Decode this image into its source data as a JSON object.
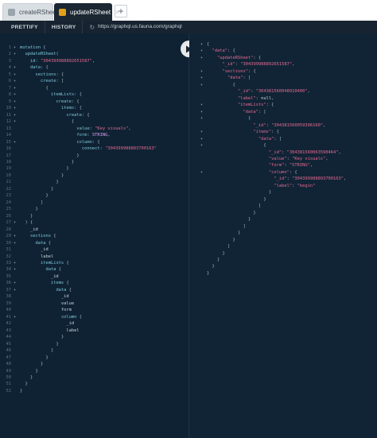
{
  "tabs": [
    {
      "label": "createRSheet",
      "active": false
    },
    {
      "label": "updateRSheet",
      "active": true
    }
  ],
  "toolbar": {
    "prettify_label": "PRETTIFY",
    "history_label": "HISTORY",
    "url": "https://graphql.us.fauna.com/graphql"
  },
  "query_lines": [
    {
      "n": "1",
      "t": "mutation {"
    },
    {
      "n": "2",
      "t": "  updateRSheet("
    },
    {
      "n": "3",
      "t": "    id: \"304399988892651587\","
    },
    {
      "n": "4",
      "t": "    data: {"
    },
    {
      "n": "5",
      "t": "      sections: {"
    },
    {
      "n": "6",
      "t": "        create: ["
    },
    {
      "n": "7",
      "t": "          {"
    },
    {
      "n": "8",
      "t": "            itemLists: {"
    },
    {
      "n": "9",
      "t": "              create: {"
    },
    {
      "n": "10",
      "t": "                items: {"
    },
    {
      "n": "11",
      "t": "                  create: {"
    },
    {
      "n": "12",
      "t": "                    {"
    },
    {
      "n": "13",
      "t": "                      value: \"Key visuals\","
    },
    {
      "n": "14",
      "t": "                      form: STRING,"
    },
    {
      "n": "15",
      "t": "                      column: {"
    },
    {
      "n": "16",
      "t": "                        connect: \"304399988893700163\""
    },
    {
      "n": "17",
      "t": "                      }"
    },
    {
      "n": "18",
      "t": "                    }"
    },
    {
      "n": "19",
      "t": "                  }"
    },
    {
      "n": "20",
      "t": "                }"
    },
    {
      "n": "21",
      "t": "              }"
    },
    {
      "n": "22",
      "t": "            }"
    },
    {
      "n": "23",
      "t": "          }"
    },
    {
      "n": "24",
      "t": "        ]"
    },
    {
      "n": "25",
      "t": "      }"
    },
    {
      "n": "26",
      "t": "    }"
    },
    {
      "n": "27",
      "t": "  ) {"
    },
    {
      "n": "28",
      "t": "    _id"
    },
    {
      "n": "29",
      "t": "    sections {"
    },
    {
      "n": "30",
      "t": "      data {"
    },
    {
      "n": "31",
      "t": "        _id"
    },
    {
      "n": "32",
      "t": "        label"
    },
    {
      "n": "33",
      "t": "        itemLists {"
    },
    {
      "n": "34",
      "t": "          data {"
    },
    {
      "n": "35",
      "t": "            _id"
    },
    {
      "n": "36",
      "t": "            items {"
    },
    {
      "n": "37",
      "t": "              data {"
    },
    {
      "n": "38",
      "t": "                _id"
    },
    {
      "n": "39",
      "t": "                value"
    },
    {
      "n": "40",
      "t": "                form"
    },
    {
      "n": "41",
      "t": "                column {"
    },
    {
      "n": "42",
      "t": "                  _id"
    },
    {
      "n": "43",
      "t": "                  label"
    },
    {
      "n": "44",
      "t": "                }"
    },
    {
      "n": "45",
      "t": "              }"
    },
    {
      "n": "46",
      "t": "            }"
    },
    {
      "n": "47",
      "t": "          }"
    },
    {
      "n": "48",
      "t": "        }"
    },
    {
      "n": "49",
      "t": "      }"
    },
    {
      "n": "50",
      "t": "    }"
    },
    {
      "n": "51",
      "t": "  }"
    },
    {
      "n": "52",
      "t": "}"
    }
  ],
  "result_lines": [
    "{",
    "  \"data\": {",
    "    \"updateRSheet\": {",
    "      \"_id\": \"304399988892651587\",",
    "      \"sections\": {",
    "        \"data\": [",
    "          {",
    "            \"_id\": \"304381560048910400\",",
    "            \"label\": null,",
    "            \"itemLists\": {",
    "              \"data\": [",
    "                {",
    "                  \"_id\": \"304381560059396160\",",
    "                  \"items\": {",
    "                    \"data\": [",
    "                      {",
    "                        \"_id\": \"304381560063590464\",",
    "                        \"value\": \"Key visuals\",",
    "                        \"form\": \"STRING\",",
    "                        \"column\": {",
    "                          \"_id\": \"304399988893700163\",",
    "                          \"label\": \"begin\"",
    "                        }",
    "                      }",
    "                    ]",
    "                  }",
    "                }",
    "              ]",
    "            }",
    "          }",
    "        ]",
    "      }",
    "    }",
    "  }",
    "}"
  ],
  "icons": {
    "run": "play-icon",
    "history": "history-icon",
    "tab": "graphql-tab-icon",
    "add_tab": "plus-icon",
    "close_tab": "close-icon"
  },
  "colors": {
    "editor_bg": "#0f2233",
    "string": "#e56a90",
    "field": "#7ec7d7",
    "enum": "#d9a0f0",
    "tab_accent": "#e4a11b"
  }
}
